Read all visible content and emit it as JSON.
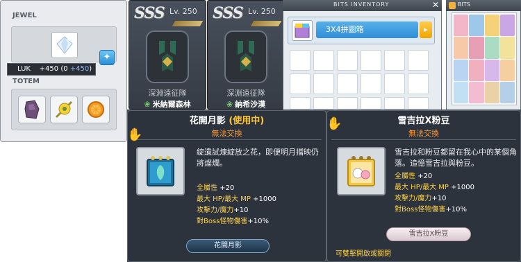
{
  "jewel_panel": {
    "jewel_label": "JEWEL",
    "totem_label": "TOTEM",
    "stat_tooltip": {
      "stat": "LUK",
      "value": "+450",
      "paren_open": "(0",
      "paren_value": "+450",
      "paren_close": ")"
    },
    "totems": [
      "purple-totem-icon",
      "sunflower-totem-icon",
      "orange-slice-totem-icon"
    ]
  },
  "cards": [
    {
      "grade": "SSS",
      "level": "Lv. 250",
      "subtitle": "深淵遠征隊",
      "name": "米納爾森林"
    },
    {
      "grade": "SSS",
      "level": "Lv. 250",
      "subtitle": "深淵遠征隊",
      "name": "納希沙漠"
    }
  ],
  "bits_inventory": {
    "title": "BITS INVENTORY",
    "close": "✕",
    "selected_item": "3X4拼圖箱",
    "arrow": "▸"
  },
  "bits_panel": {
    "title": "BITS"
  },
  "tooltip_left": {
    "title": "花開月影",
    "status": "(使用中)",
    "trade": "無法交換",
    "description": "綻遺試煉綻放之花，即便明月擋映仍將燦爛。",
    "stats": [
      {
        "label": "全屬性",
        "value": "+20"
      },
      {
        "label": "最大 HP/最大 MP",
        "value": "+1000"
      },
      {
        "label": "攻擊力/魔力",
        "value": "+10"
      },
      {
        "label": "對Boss怪物傷害",
        "value": "+10%"
      }
    ],
    "nameplate": "花開月影"
  },
  "tooltip_right": {
    "title": "雪吉拉X粉豆",
    "trade": "無法交換",
    "description": "雪吉拉和粉豆都留在我心中的某個角落。追憶雪吉拉與粉豆。",
    "stats": [
      {
        "label": "全屬性",
        "value": "+20"
      },
      {
        "label": "最大 HP/最大 MP",
        "value": "+1000"
      },
      {
        "label": "攻擊力/魔力",
        "value": "+10"
      },
      {
        "label": "對Boss怪物傷害",
        "value": "+10%"
      }
    ],
    "nameplate": "雪吉拉X粉豆",
    "footer": "可雙擊開啟或關閉"
  },
  "colors": {
    "accent_blue": "#2f8ed6",
    "stat_gold": "#ffd34a",
    "warn_orange": "#ff9b3a",
    "tooltip_bg": "#2c333c"
  }
}
